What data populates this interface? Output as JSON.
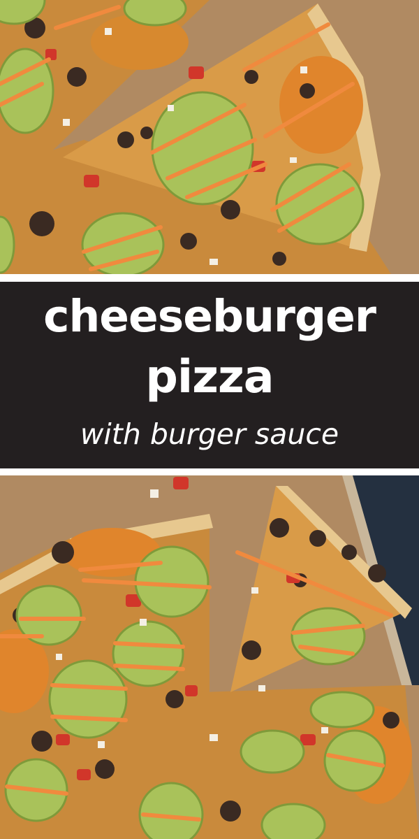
{
  "title": {
    "line1": "cheeseburger",
    "line2": "pizza",
    "subtitle": "with burger sauce"
  },
  "colors": {
    "band_background": "#231f20",
    "text": "#ffffff",
    "parchment": "#b08a62",
    "crust": "#d9a55a",
    "pickle": "#a9c25a",
    "sauce_drizzle": "#f08a3e",
    "beef": "#3a2a22",
    "tomato": "#d1362a"
  },
  "images": {
    "top": "overhead-pizza-slices-with-pickles-photo",
    "bottom": "sliced-cheeseburger-pizza-photo"
  }
}
